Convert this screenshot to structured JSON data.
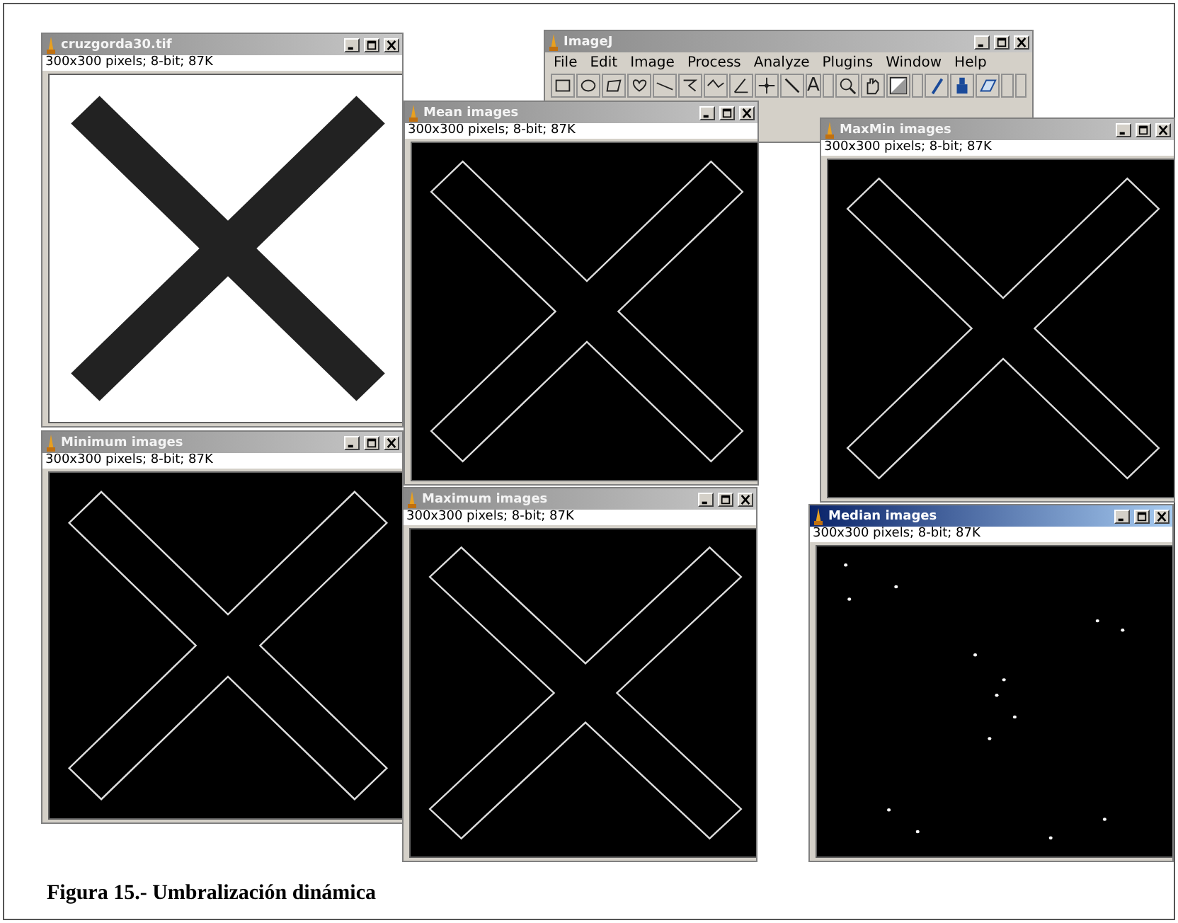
{
  "windows": [
    {
      "title": "cruzgorda30.tif",
      "info": "300x300 pixels; 8-bit; 87K",
      "active": false,
      "image": {
        "kind": "solid-cross"
      }
    },
    {
      "kind": "toolbar",
      "title": "ImageJ",
      "active": false,
      "menu": [
        "File",
        "Edit",
        "Image",
        "Process",
        "Analyze",
        "Plugins",
        "Window",
        "Help"
      ],
      "text_tool": "A"
    },
    {
      "title": "Mean images",
      "info": "300x300 pixels; 8-bit; 87K",
      "active": false,
      "image": {
        "kind": "outline-cross"
      }
    },
    {
      "title": "MaxMin images",
      "info": "300x300 pixels; 8-bit; 87K",
      "active": false,
      "image": {
        "kind": "outline-cross"
      }
    },
    {
      "title": "Minimum images",
      "info": "300x300 pixels; 8-bit; 87K",
      "active": false,
      "image": {
        "kind": "outline-cross"
      }
    },
    {
      "title": "Maximum images",
      "info": "300x300 pixels; 8-bit; 87K",
      "active": false,
      "image": {
        "kind": "outline-cross"
      }
    },
    {
      "title": "Median images",
      "info": "300x300 pixels; 8-bit; 87K",
      "active": true,
      "image": {
        "kind": "sparse-dots"
      }
    }
  ],
  "caption": "Figura 15.- Umbralización dinámica"
}
